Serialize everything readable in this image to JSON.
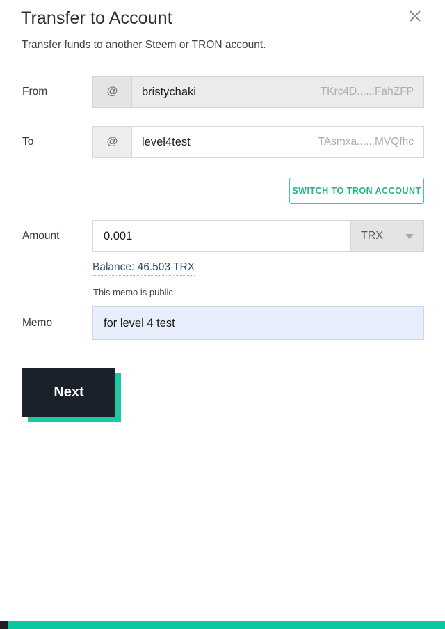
{
  "dialog": {
    "title": "Transfer to Account",
    "subtitle": "Transfer funds to another Steem or TRON account.",
    "close_label": "×"
  },
  "form": {
    "from": {
      "label": "From",
      "prefix": "@",
      "account": "bristychaki",
      "address": "TKrc4D......FahZFP"
    },
    "to": {
      "label": "To",
      "prefix": "@",
      "account": "level4test",
      "address": "TAsmxa......MVQfhc"
    },
    "switch_button": "SWITCH TO TRON ACCOUNT",
    "amount": {
      "label": "Amount",
      "value": "0.001",
      "currency": "TRX"
    },
    "balance": "Balance: 46.503 TRX",
    "memo": {
      "label": "Memo",
      "hint": "This memo is public",
      "value": "for level 4 test"
    },
    "next_button": "Next"
  },
  "colors": {
    "accent_teal": "#1dc9a0",
    "button_dark": "#1b212b",
    "link_blue": "#31536e",
    "memo_fill": "#e8eefb",
    "bottom_bar": "#07c9a0"
  }
}
